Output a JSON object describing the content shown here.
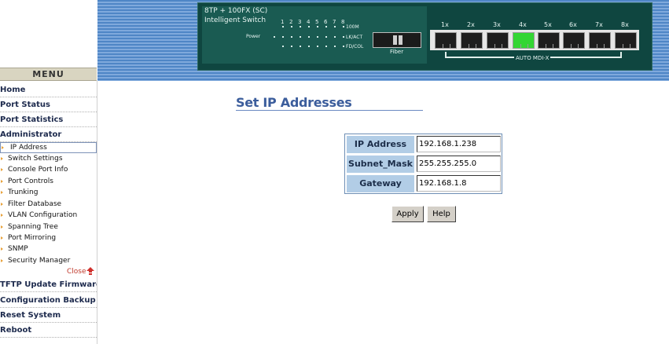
{
  "device": {
    "title": "8TP + 100FX (SC)",
    "subtitle": "Intelligent Switch",
    "power_label": "Power",
    "led_numbers": [
      "1",
      "2",
      "3",
      "4",
      "5",
      "6",
      "7",
      "8"
    ],
    "led_labels": [
      "100M",
      "LK/ACT",
      "FD/COL"
    ],
    "fiber_label": "Fiber",
    "port_labels": [
      "1x",
      "2x",
      "3x",
      "4x",
      "5x",
      "6x",
      "7x",
      "8x"
    ],
    "active_port": "4x",
    "auto_mdix_label": "AUTO MDI-X",
    "colors": {
      "panel": "#0f4640",
      "active_port": "#33d633",
      "banner": "#4f86c6"
    }
  },
  "sidebar": {
    "menu_header": "MENU",
    "main_items": [
      {
        "label": "Home"
      },
      {
        "label": "Port Status"
      },
      {
        "label": "Port Statistics"
      },
      {
        "label": "Administrator"
      }
    ],
    "sub_items": [
      {
        "label": "IP Address"
      },
      {
        "label": "Switch Settings"
      },
      {
        "label": "Console Port Info"
      },
      {
        "label": "Port Controls"
      },
      {
        "label": "Trunking"
      },
      {
        "label": "Filter Database"
      },
      {
        "label": "VLAN Configuration"
      },
      {
        "label": "Spanning Tree"
      },
      {
        "label": "Port Mirroring"
      },
      {
        "label": "SNMP"
      },
      {
        "label": "Security Manager"
      }
    ],
    "selected_sub_item": "IP Address",
    "close_label": "Close",
    "bottom_items": [
      {
        "label": "TFTP Update Firmware"
      },
      {
        "label": "Configuration Backup"
      },
      {
        "label": "Reset System"
      },
      {
        "label": "Reboot"
      }
    ]
  },
  "main": {
    "title": "Set IP Addresses",
    "fields": [
      {
        "label": "IP Address",
        "value": "192.168.1.238"
      },
      {
        "label": "Subnet_Mask",
        "value": "255.255.255.0"
      },
      {
        "label": "Gateway",
        "value": "192.168.1.8"
      }
    ],
    "apply_label": "Apply",
    "help_label": "Help"
  }
}
